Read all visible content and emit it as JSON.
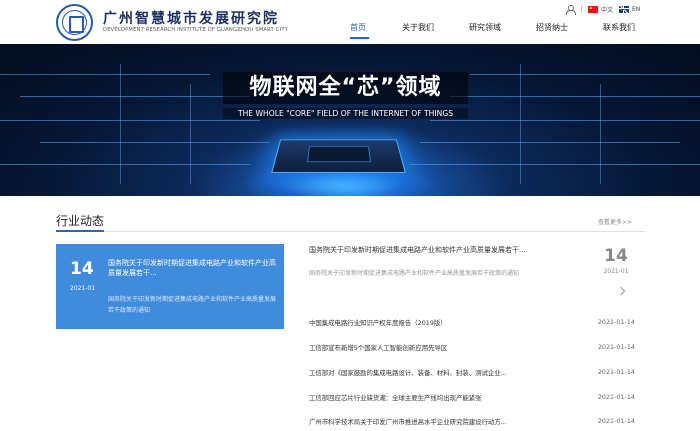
{
  "header": {
    "logo_cn": "广州智慧城市发展研究院",
    "logo_en": "DEVELOPMENT RESEARCH INSTITUTE OF GUANGZHOU SMART CITY",
    "lang_cn": "中文",
    "lang_en": "EN"
  },
  "nav": {
    "items": [
      {
        "label": "首页"
      },
      {
        "label": "关于我们"
      },
      {
        "label": "研究领域"
      },
      {
        "label": "招贤纳士"
      },
      {
        "label": "联系我们"
      }
    ],
    "active": "首页"
  },
  "banner": {
    "title": "物联网全“芯”领域",
    "subtitle": "THE WHOLE \"CORE\" FIELD OF THE INTERNET OF THINGS",
    "slide_count": 3,
    "active_slide": 1
  },
  "news": {
    "section_title": "行业动态",
    "more_label": "查看更多>>",
    "featured": {
      "day": "14",
      "year_month": "2021-01",
      "title": "国务院关于印发新时期促进集成电路产业和软件产业高质量发展若干...",
      "desc": "国务院关于印发新时期促进集成电路产业和软件产业高质量发展若干政策的通知"
    },
    "top": {
      "title": "国务院关于印发新时期促进集成电路产业和软件产业高质量发展若干...",
      "desc": "国务院关于印发新时期促进集成电路产业和软件产业高质量发展若干政策的通知",
      "day": "14",
      "year_month": "2021-01"
    },
    "list": [
      {
        "title": "中国集成电路行业知识产权年度报告（2019版）",
        "date": "2021-01-14"
      },
      {
        "title": "工信部宣布新增5个国家人工智能创新应用先导区",
        "date": "2021-01-14"
      },
      {
        "title": "工信部对《国家鼓励的集成电路设计、装备、材料、封装、测试企业...",
        "date": "2021-01-14"
      },
      {
        "title": "工信部回应芯片行业缺货潮：全球主要生产线均出现产能紧张",
        "date": "2021-01-14"
      },
      {
        "title": "广州市科学技术局关于印发广州市推进高水平企业研究院建设行动方...",
        "date": "2021-01-14"
      }
    ]
  }
}
